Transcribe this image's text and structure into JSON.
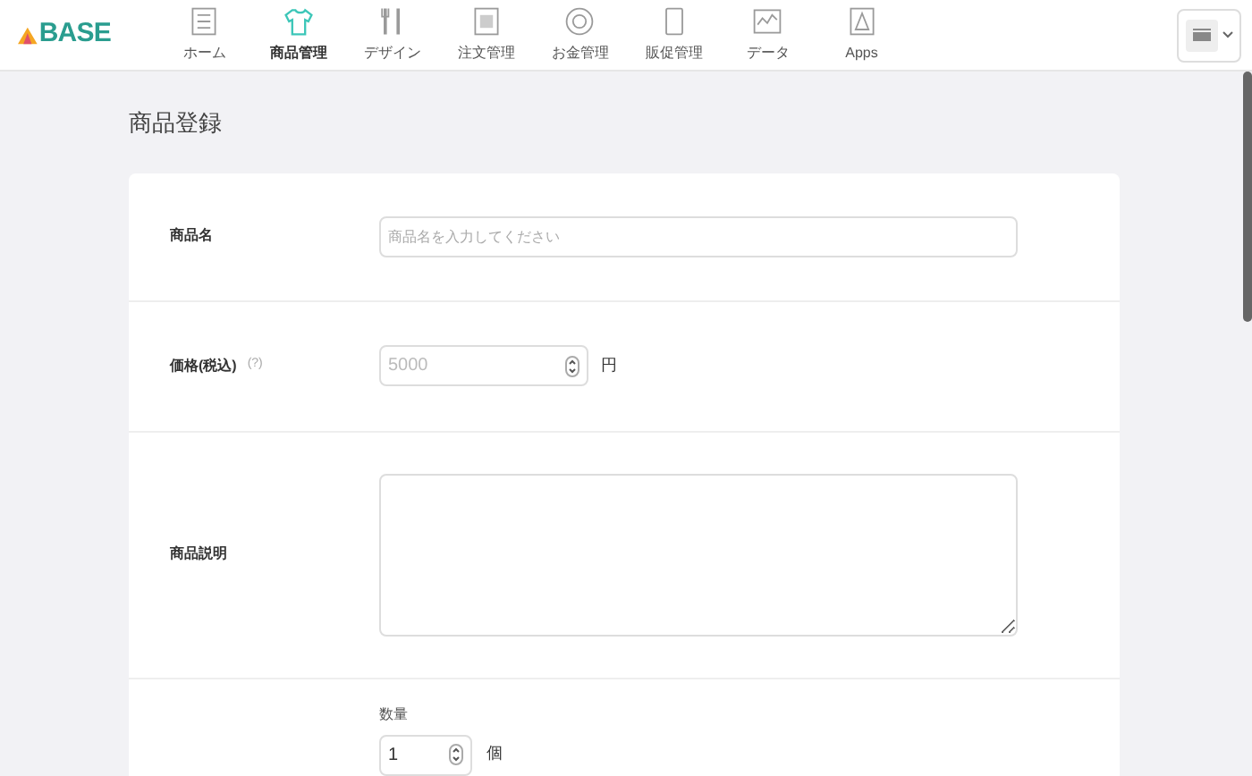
{
  "logo": "BASE",
  "nav": [
    {
      "label": "ホーム",
      "selected": false
    },
    {
      "label": "商品管理",
      "selected": true
    },
    {
      "label": "デザイン",
      "selected": false
    },
    {
      "label": "注文管理",
      "selected": false
    },
    {
      "label": "お金管理",
      "selected": false
    },
    {
      "label": "販促管理",
      "selected": false
    },
    {
      "label": "データ",
      "selected": false
    },
    {
      "label": "Apps",
      "selected": false
    }
  ],
  "page_title": "商品登録",
  "form": {
    "name": {
      "label": "商品名",
      "placeholder": "商品名を入力してください"
    },
    "price": {
      "label": "価格(税込)",
      "help": "(?)",
      "placeholder": "5000",
      "unit": "円"
    },
    "description": {
      "label": "商品説明"
    },
    "stock": {
      "sublabel": "数量",
      "value": "1",
      "unit": "個"
    }
  }
}
